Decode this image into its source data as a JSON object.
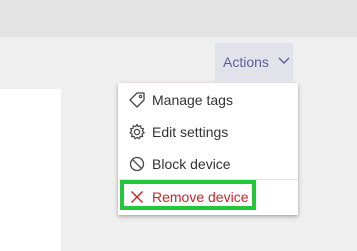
{
  "header": {
    "actions_label": "Actions"
  },
  "menu": {
    "items": [
      {
        "label": "Manage tags",
        "icon": "tag-icon"
      },
      {
        "label": "Edit settings",
        "icon": "gear-icon"
      },
      {
        "label": "Block device",
        "icon": "block-icon"
      },
      {
        "label": "Remove device",
        "icon": "close-icon",
        "color": "#c1272d"
      }
    ]
  },
  "highlight": {
    "color": "#22c73a"
  }
}
